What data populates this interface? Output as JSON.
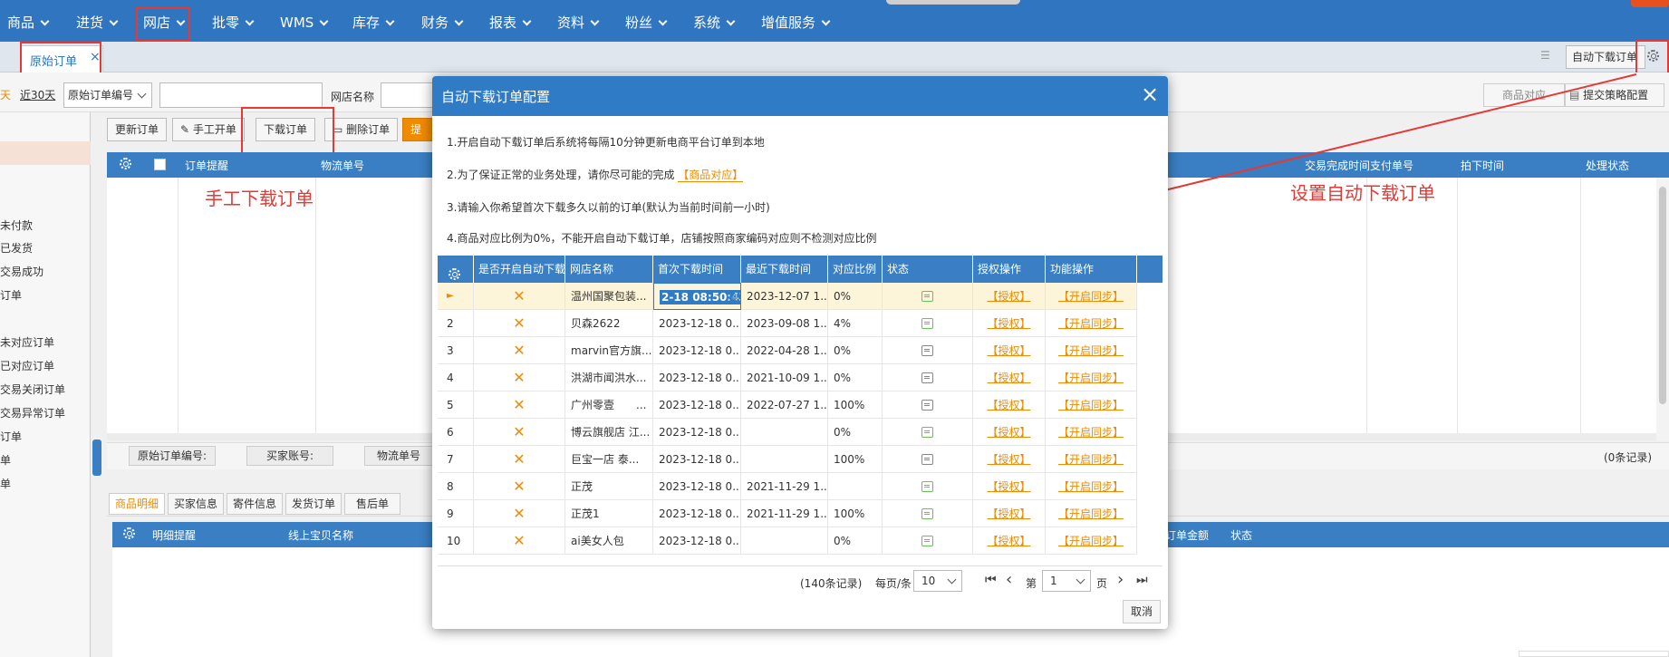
{
  "nav": [
    "商品",
    "进货",
    "网店",
    "批零",
    "WMS",
    "库存",
    "财务",
    "报表",
    "资料",
    "粉丝",
    "系统",
    "增值服务"
  ],
  "tabs": {
    "active": "原始订单",
    "close": "×",
    "right_label": "自动下载订单"
  },
  "filter": {
    "day_fragment": "天",
    "last30": "近30天",
    "order_field": "原始订单编号",
    "shop_label": "网店名称",
    "match_btn": "商品对应",
    "strategy_btn": "提交策略配置"
  },
  "toolbar": {
    "update": "更新订单",
    "manual_open": "手工开单",
    "download": "下载订单",
    "delete": "删除订单",
    "more": "提"
  },
  "grid": {
    "headers": [
      "订单提醒",
      "物流单号"
    ],
    "right_headers": [
      "交易完成时间",
      "支付单号",
      "拍下时间",
      "处理状态"
    ],
    "footer_fields": [
      "原始订单编号:",
      "买家账号:",
      "物流单号"
    ],
    "records": "(0条记录)"
  },
  "sidebar": [
    "未付款",
    "已发货",
    "交易成功",
    "订单",
    "未对应订单",
    "已对应订单",
    "交易关闭订单",
    "交易异常订单",
    "订单",
    "单",
    "单"
  ],
  "detail": {
    "tabs": [
      "商品明细",
      "买家信息",
      "寄件信息",
      "发货订单",
      "售后单"
    ],
    "headers": [
      "明细提醒",
      "线上宝贝名称",
      "订单金额",
      "状态"
    ]
  },
  "annotations": {
    "manual": "手工下载订单",
    "auto": "设置自动下载订单"
  },
  "modal": {
    "title": "自动下载订单配置",
    "close": "×",
    "note1": "1.开启自动下载订单后系统将每隔10分钟更新电商平台订单到本地",
    "note2_prefix": "2.为了保证正常的业务处理，请你尽可能的完成",
    "note2_link": "【商品对应】",
    "note3": "3.请输入你希望首次下载多久以前的订单(默认为当前时间前一小时)",
    "note4": "4.商品对应比例为0%，不能开启自动下载订单，店铺按照商家编码对应则不检测对应比例",
    "columns": [
      "是否开启自动下载",
      "网店名称",
      "首次下载时间",
      "最近下载时间",
      "对应比例",
      "状态",
      "授权操作",
      "功能操作"
    ],
    "rows": [
      {
        "no": "►",
        "enabled": "✕",
        "shop": "温州国聚包装...",
        "first": "2-18 08:50:43",
        "last": "2023-12-07 1...",
        "ratio": "0%",
        "status": "on",
        "auth": "【授权】",
        "func": "【开启同步】"
      },
      {
        "no": "2",
        "enabled": "✕",
        "shop": "贝森2622",
        "first": "2023-12-18 0...",
        "last": "2023-09-08 1...",
        "ratio": "4%",
        "status": "on",
        "auth": "【授权】",
        "func": "【开启同步】"
      },
      {
        "no": "3",
        "enabled": "✕",
        "shop": "marvin官方旗...",
        "first": "2023-12-18 0...",
        "last": "2022-04-28 1...",
        "ratio": "0%",
        "status": "off",
        "auth": "【授权】",
        "func": "【开启同步】"
      },
      {
        "no": "4",
        "enabled": "✕",
        "shop": "洪湖市闻洪水...",
        "first": "2023-12-18 0...",
        "last": "2021-10-09 1...",
        "ratio": "0%",
        "status": "off",
        "auth": "【授权】",
        "func": "【开启同步】"
      },
      {
        "no": "5",
        "enabled": "✕",
        "shop": "广州零壹　　...",
        "first": "2023-12-18 0...",
        "last": "2022-07-27 1...",
        "ratio": "100%",
        "status": "off",
        "auth": "【授权】",
        "func": "【开启同步】"
      },
      {
        "no": "6",
        "enabled": "✕",
        "shop": "博云旗舰店 江...",
        "first": "2023-12-18 0...",
        "last": "",
        "ratio": "0%",
        "status": "on",
        "auth": "【授权】",
        "func": "【开启同步】"
      },
      {
        "no": "7",
        "enabled": "✕",
        "shop": "巨宝一店 泰...",
        "first": "2023-12-18 0...",
        "last": "",
        "ratio": "100%",
        "status": "off",
        "auth": "【授权】",
        "func": "【开启同步】"
      },
      {
        "no": "8",
        "enabled": "✕",
        "shop": "正茂",
        "first": "2023-12-18 0...",
        "last": "2021-11-29 1...",
        "ratio": "",
        "status": "on",
        "auth": "【授权】",
        "func": "【开启同步】"
      },
      {
        "no": "9",
        "enabled": "✕",
        "shop": "正茂1",
        "first": "2023-12-18 0...",
        "last": "2021-11-29 1...",
        "ratio": "100%",
        "status": "on",
        "auth": "【授权】",
        "func": "【开启同步】"
      },
      {
        "no": "10",
        "enabled": "✕",
        "shop": "ai美女人包",
        "first": "2023-12-18 0...",
        "last": "",
        "ratio": "0%",
        "status": "on",
        "auth": "【授权】",
        "func": "【开启同步】"
      }
    ],
    "pager": {
      "records": "(140条记录)",
      "per_page_label": "每页/条",
      "per_page": "10",
      "page_prefix": "第",
      "page": "1",
      "page_suffix": "页",
      "first": "⏮",
      "prev": "‹",
      "next": "›",
      "last": "⏭"
    },
    "cancel": "取消"
  }
}
